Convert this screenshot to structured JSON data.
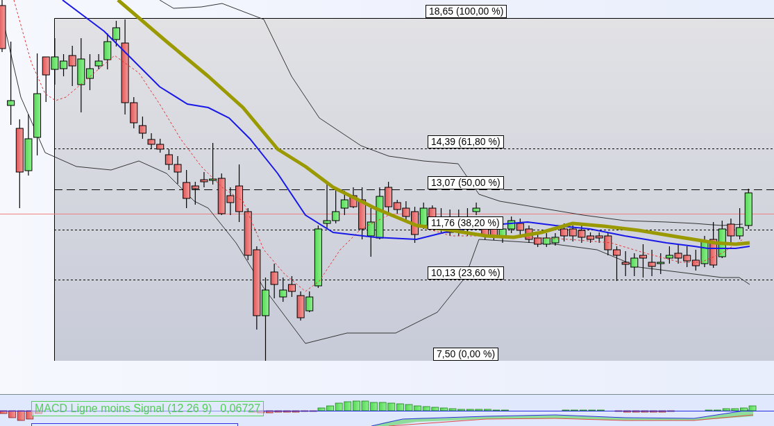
{
  "chart": {
    "fib_levels": [
      {
        "label": "18,65 (100,00 %)",
        "kind": "edge"
      },
      {
        "label": "14,39 (61,80 %)",
        "kind": "dotted"
      },
      {
        "label": "13,07 (50,00 %)",
        "kind": "dashed"
      },
      {
        "label": "11,76 (38,20 %)",
        "kind": "dotted"
      },
      {
        "label": "10,13 (23,60 %)",
        "kind": "dotted"
      },
      {
        "label": "7,50 (0,00 %)",
        "kind": "edge"
      }
    ]
  },
  "macd_panel": {
    "label": "MACD Ligne moins Signal (12 26 9)",
    "value": "0,06727"
  }
}
